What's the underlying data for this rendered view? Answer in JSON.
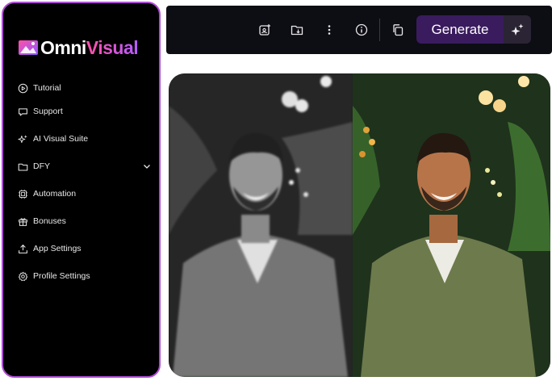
{
  "app": {
    "logo_prefix": "Omni",
    "logo_suffix": "Visual"
  },
  "sidebar": {
    "items": [
      {
        "label": "Tutorial",
        "icon": "play-circle-icon"
      },
      {
        "label": "Support",
        "icon": "chat-bubble-icon"
      },
      {
        "label": "AI Visual Suite",
        "icon": "sparkles-icon"
      },
      {
        "label": "DFY",
        "icon": "folder-icon",
        "expandable": true
      },
      {
        "label": "Automation",
        "icon": "chip-icon"
      },
      {
        "label": "Bonuses",
        "icon": "gift-icon"
      },
      {
        "label": "App Settings",
        "icon": "upload-icon"
      },
      {
        "label": "Profile Settings",
        "icon": "gear-icon"
      }
    ]
  },
  "toolbar": {
    "generate_label": "Generate",
    "accent_color": "#3a1b5e"
  },
  "colors": {
    "sidebar_border": "#b04dd6",
    "brand_gradient": [
      "#ff4fa8",
      "#b55cff"
    ]
  }
}
